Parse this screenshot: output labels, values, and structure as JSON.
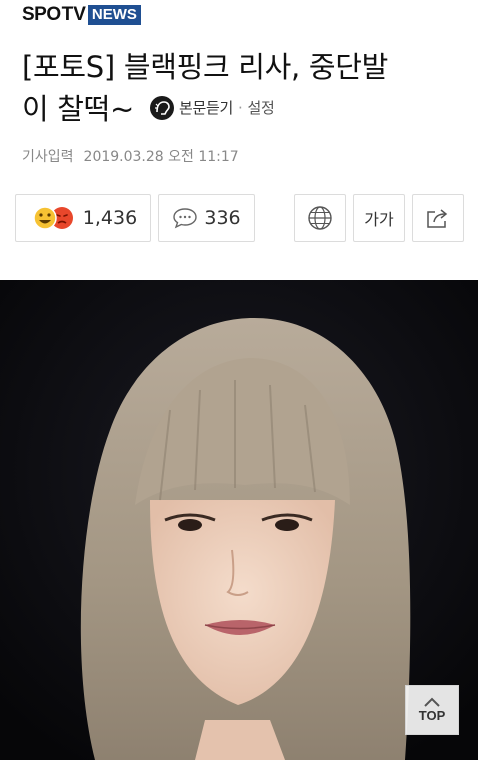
{
  "header": {
    "logo_spo": "SPO",
    "logo_tv": "TV",
    "logo_news": "NEWS"
  },
  "article": {
    "title_line1": "[포토S] 블랙핑크 리사, 중단발",
    "title_line2": "이 찰떡~",
    "listen_label": "본문듣기",
    "separator": "·",
    "settings_label": "설정",
    "meta_label": "기사입력",
    "meta_date": "2019.03.28 오전 11:17"
  },
  "actions": {
    "reaction_count": "1,436",
    "comment_count": "336",
    "font_label": "가가"
  },
  "top_button": {
    "label": "TOP"
  },
  "colors": {
    "brand_blue": "#1f4f92",
    "meta_gray": "#888888",
    "border_gray": "#dcdcdc"
  }
}
